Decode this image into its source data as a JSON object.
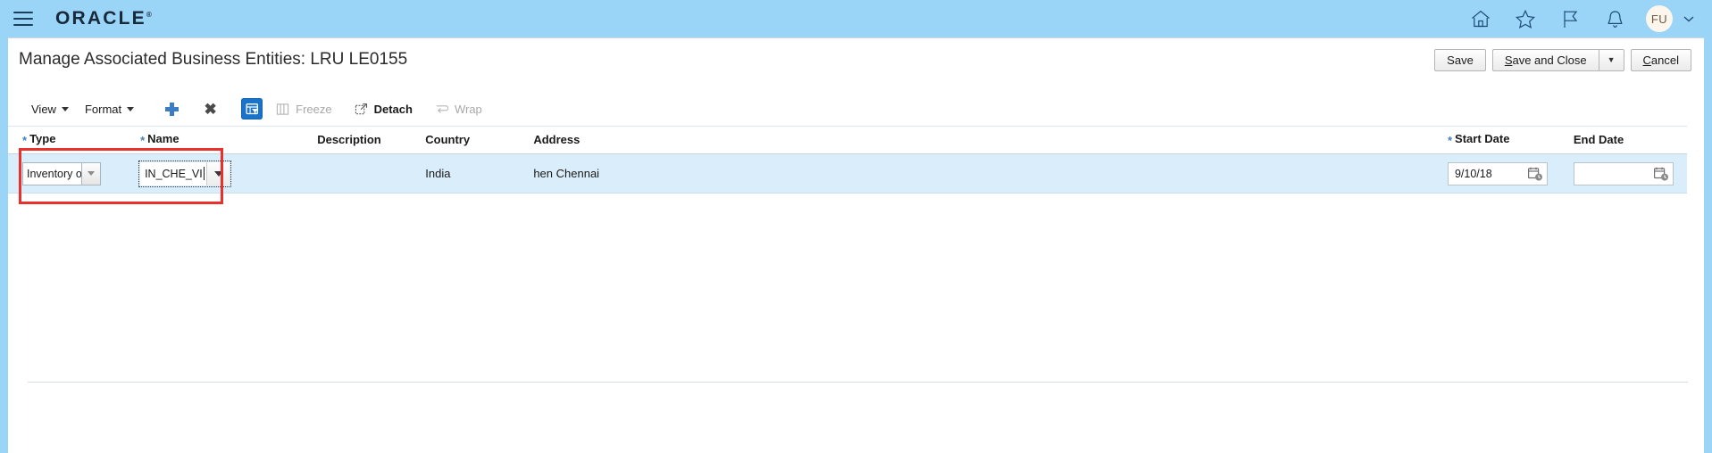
{
  "global_header": {
    "menu_icon": "hamburger-menu-icon",
    "logo_text": "ORACLE",
    "logo_registered": "®",
    "icons": [
      {
        "name": "home-icon",
        "label": "Home"
      },
      {
        "name": "favorites-star-icon",
        "label": "Favorites and Recent Items"
      },
      {
        "name": "flag-icon",
        "label": "Watchlist"
      },
      {
        "name": "bell-icon",
        "label": "Notifications"
      }
    ],
    "avatar_initials": "FU",
    "avatar_chevron": "chevron-down-icon"
  },
  "page": {
    "title": "Manage Associated Business Entities: LRU LE0155",
    "actions": {
      "save": "Save",
      "save_and_close": "Save and Close",
      "save_and_close_accesskey": "S",
      "save_and_close_rest": "ave and Close",
      "dropdown_arrow": "▼",
      "cancel": "Cancel",
      "cancel_accesskey": "C",
      "cancel_rest": "ancel"
    }
  },
  "toolbar": {
    "view": "View",
    "format": "Format",
    "add_icon": "plus-icon",
    "delete_icon": "x-mark-icon",
    "query_by_example": "query-by-example-icon",
    "freeze": "Freeze",
    "freeze_enabled": false,
    "detach": "Detach",
    "detach_enabled": true,
    "wrap": "Wrap",
    "wrap_enabled": false
  },
  "table": {
    "columns": [
      {
        "key": "type",
        "label": "Type",
        "required": true
      },
      {
        "key": "name",
        "label": "Name",
        "required": true
      },
      {
        "key": "description",
        "label": "Description",
        "required": false
      },
      {
        "key": "country",
        "label": "Country",
        "required": false
      },
      {
        "key": "address",
        "label": "Address",
        "required": false
      },
      {
        "key": "start_date",
        "label": "Start Date",
        "required": true
      },
      {
        "key": "end_date",
        "label": "End Date",
        "required": false
      }
    ],
    "required_marker": "*",
    "rows": [
      {
        "type": "Inventory or",
        "name": "IN_CHE_VI",
        "description": "",
        "country": "India",
        "address": "hen Chennai",
        "start_date": "9/10/18",
        "end_date": ""
      }
    ]
  },
  "annotation": {
    "color": "#e8302c",
    "shape": "rectangle-highlight"
  }
}
